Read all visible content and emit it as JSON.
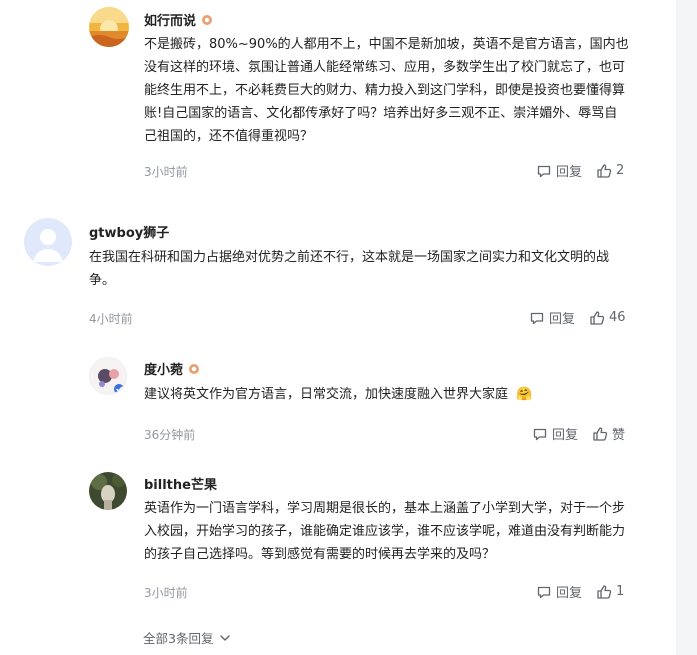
{
  "comments": [
    {
      "author": "如行而说",
      "text": "不是搬砖，80%~90%的人都用不上，中国不是新加坡，英语不是官方语言，国内也没有这样的环境、氛围让普通人能经常练习、应用，多数学生出了校门就忘了，也可能终生用不上，不必耗费巨大的财力、精力投入到这门学科，即使是投资也要懂得算账!自己国家的语言、文化都传承好了吗？培养出好多三观不正、崇洋媚外、辱骂自己祖国的，还不值得重视吗？",
      "time": "3小时前",
      "reply_label": "回复",
      "likes": "2"
    },
    {
      "author": "gtwboy狮子",
      "text": "在我国在科研和国力占据绝对优势之前还不行，这本就是一场国家之间实力和文化文明的战争。",
      "time": "4小时前",
      "reply_label": "回复",
      "likes": "46"
    },
    {
      "author": "度小菀",
      "text": "建议将英文作为官方语言，日常交流，加快速度融入世界大家庭",
      "emoji": "🤗",
      "time": "36分钟前",
      "reply_label": "回复",
      "likes": "赞"
    },
    {
      "author": "billthe芒果",
      "text": "英语作为一门语言学科，学习周期是很长的，基本上涵盖了小学到大学，对于一个步入校园，开始学习的孩子，谁能确定谁应该学，谁不应该学呢，难道由没有判断能力的孩子自己选择吗。等到感觉有需要的时候再去学来的及吗？",
      "time": "3小时前",
      "reply_label": "回复",
      "likes": "1"
    }
  ],
  "more_replies": "全部3条回复",
  "colors": {
    "muted": "#9499a0",
    "action": "#61666d",
    "rail": "#f4f5f7"
  }
}
